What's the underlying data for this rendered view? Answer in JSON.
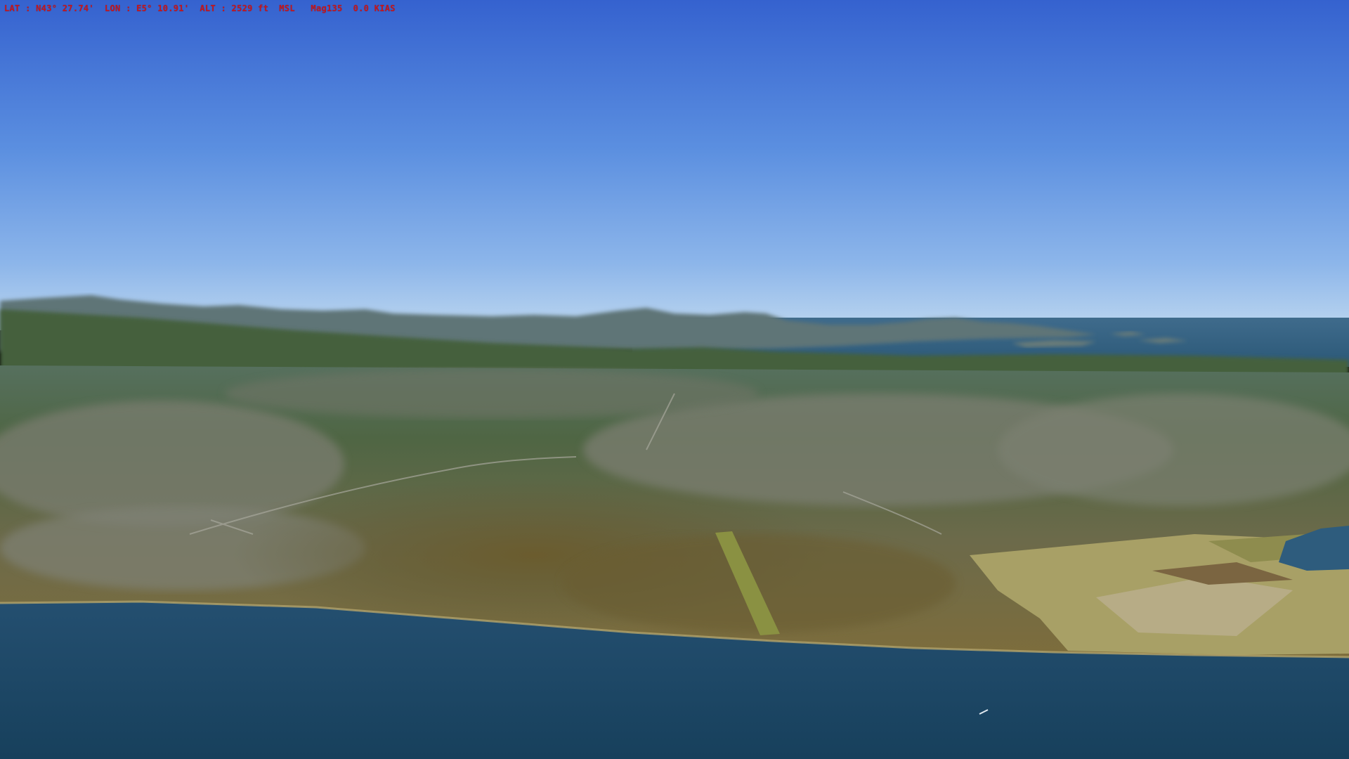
{
  "hud": {
    "readout": "LAT : N43° 27.74'  LON : E5° 10.91'  ALT : 2529 ft  MSL   Mag135  0.0 KIAS"
  },
  "colors": {
    "hud_text": "#c8141a",
    "sky_top": "#3968d4",
    "sky_horizon": "#b6d2ee",
    "sea": "#1d4766",
    "shoreline": "#9a8a55",
    "land_urban": "#6f7361",
    "land_forest": "#3f5a34",
    "land_scrub": "#6e6033",
    "fields": "#a89c5c",
    "distant_hills": "#5a6f74"
  }
}
